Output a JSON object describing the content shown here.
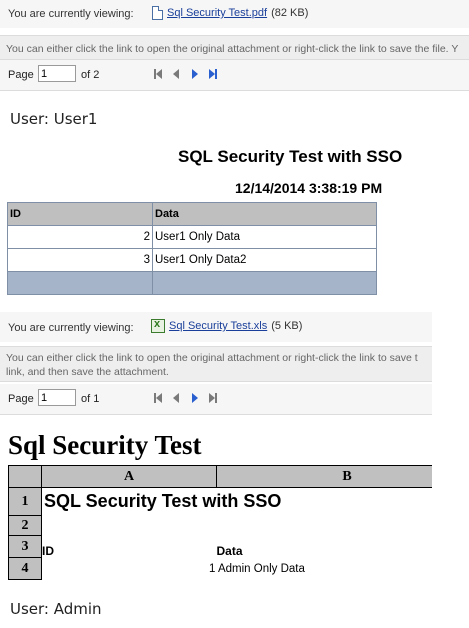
{
  "viewer1": {
    "label": "You are currently viewing:",
    "file_link": "Sql Security Test.pdf",
    "file_size": "(82 KB)",
    "hint": "You can either click the link to open the original attachment or right-click the link to save the file. Y",
    "page_label": "Page",
    "page_value": "1",
    "of_text": "of  2"
  },
  "pdf_report": {
    "user_text": "User: User1",
    "title": "SQL Security Test with SSO",
    "date": "12/14/2014 3:38:19 PM",
    "columns": [
      "ID",
      "Data"
    ],
    "rows": [
      {
        "id": "2",
        "data": "User1 Only Data"
      },
      {
        "id": "3",
        "data": "User1 Only Data2"
      }
    ]
  },
  "viewer2": {
    "label": "You are currently viewing:",
    "file_link": "Sql Security Test.xls",
    "file_size": "(5 KB)",
    "hint_line1": "You can either click the link to open the original attachment or right-click the link to save t",
    "hint_line2": "link, and then save the attachment.",
    "page_label": "Page",
    "page_value": "1",
    "of_text": "of  1"
  },
  "xls_report": {
    "sheet_title": "Sql Security Test",
    "col_headers": [
      "A",
      "B"
    ],
    "row_numbers": [
      "1",
      "2",
      "3",
      "4"
    ],
    "a1": "SQL Security Test with SSO",
    "a3": "ID",
    "b3": "Data",
    "row4_value": "1 Admin Only Data",
    "user_text": "User: Admin"
  },
  "colors": {
    "link": "#1a3f9a",
    "nav_active": "#2a5fcf",
    "table_border": "#7f8fa6",
    "footer_row": "#a6b4c9"
  },
  "icons": {
    "file1": "pdf-file-icon",
    "file2": "excel-file-icon",
    "nav": [
      "first-page-icon",
      "prev-page-icon",
      "next-page-icon",
      "last-page-icon"
    ]
  }
}
